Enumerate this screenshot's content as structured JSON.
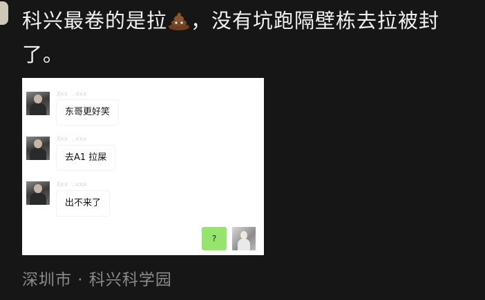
{
  "post": {
    "text_part1": "科兴最卷的是拉",
    "emoji_icon": "poop-icon",
    "text_part2": "，没有坑跑隔壁栋去拉被封了。",
    "location": "深圳市 · 科兴科学园"
  },
  "screenshot": {
    "messages": [
      {
        "sender": "Xxx .xxx",
        "text": "东哥更好笑"
      },
      {
        "sender": "Xxx .xxx",
        "text": "去A1 拉屎"
      },
      {
        "sender": "Xxx .xxx",
        "text": "出不来了"
      }
    ],
    "my_message": {
      "text": "?"
    }
  }
}
